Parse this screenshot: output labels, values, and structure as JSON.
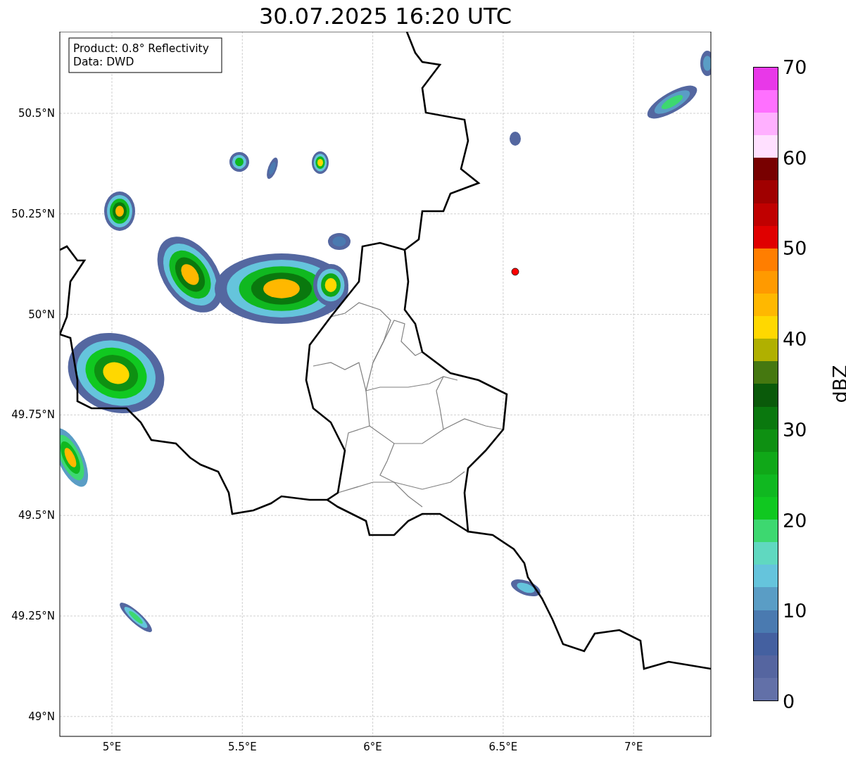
{
  "title": "30.07.2025 16:20 UTC",
  "legend": [
    "Product: 0.8° Reflectivity",
    "Data: DWD"
  ],
  "map": {
    "y_ticks": [
      "50.5°N",
      "50.25°N",
      "50°N",
      "49.75°N",
      "49.5°N",
      "49.25°N",
      "49°N"
    ],
    "x_ticks": [
      "5°E",
      "5.5°E",
      "6°E",
      "6.5°E",
      "7°E"
    ]
  },
  "colorbar": {
    "label": "dBZ",
    "ticks": [
      "70",
      "60",
      "50",
      "40",
      "30",
      "20",
      "10",
      "0"
    ],
    "segments": [
      {
        "color": "#6270a8"
      },
      {
        "color": "#5565a0"
      },
      {
        "color": "#4460a0"
      },
      {
        "color": "#4a7ab0"
      },
      {
        "color": "#5a9dc5"
      },
      {
        "color": "#65c4dc"
      },
      {
        "color": "#60d8c0"
      },
      {
        "color": "#3dd870"
      },
      {
        "color": "#10c820"
      },
      {
        "color": "#10b820"
      },
      {
        "color": "#10a818"
      },
      {
        "color": "#0e9012"
      },
      {
        "color": "#0a780e"
      },
      {
        "color": "#0a5a0a"
      },
      {
        "color": "#457810"
      },
      {
        "color": "#b0b000"
      },
      {
        "color": "#ffd800"
      },
      {
        "color": "#ffb800"
      },
      {
        "color": "#ff9a00"
      },
      {
        "color": "#ff7e00"
      },
      {
        "color": "#e00000"
      },
      {
        "color": "#c00000"
      },
      {
        "color": "#a00000"
      },
      {
        "color": "#780000"
      },
      {
        "color": "#ffe0ff"
      },
      {
        "color": "#ffb0ff"
      },
      {
        "color": "#ff70ff"
      },
      {
        "color": "#e838e8"
      }
    ]
  }
}
